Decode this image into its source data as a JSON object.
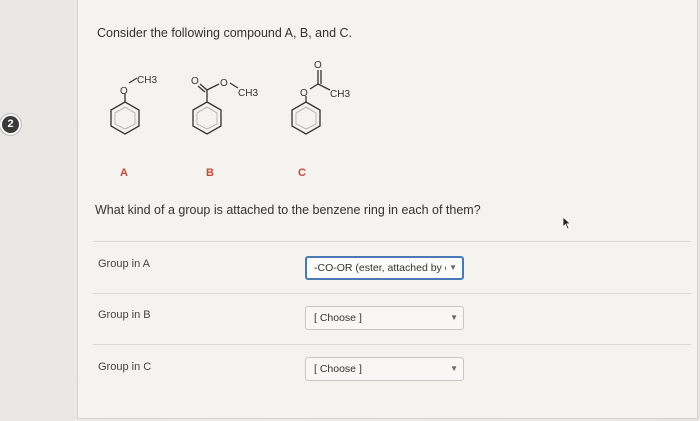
{
  "question": {
    "number": "2",
    "prompt": "Consider the following compound A, B, and C.",
    "subquestion": "What kind of a group is attached to the benzene ring in each of them?"
  },
  "structures": {
    "A": {
      "label": "A",
      "atoms": {
        "O": "O",
        "ch3": "CH3"
      }
    },
    "B": {
      "label": "B",
      "atoms": {
        "O_carbonyl": "O",
        "O_ether": "O",
        "ch3": "CH3"
      }
    },
    "C": {
      "label": "C",
      "atoms": {
        "O_carbonyl": "O",
        "O_ether": "O",
        "ch3": "CH3"
      }
    }
  },
  "rows": [
    {
      "label": "Group in A",
      "value": "-CO-OR (ester, attached by ca",
      "selected": true
    },
    {
      "label": "Group in B",
      "value": "[ Choose ]",
      "selected": false
    },
    {
      "label": "Group in C",
      "value": "[ Choose ]",
      "selected": false
    }
  ],
  "icons": {
    "dropdown": "chevron-down-icon",
    "pointer": "cursor-arrow-icon"
  },
  "colors": {
    "compound_label": "#c4483a",
    "selected_border": "#4a79b5",
    "number_badge": "#3a3a3a"
  }
}
